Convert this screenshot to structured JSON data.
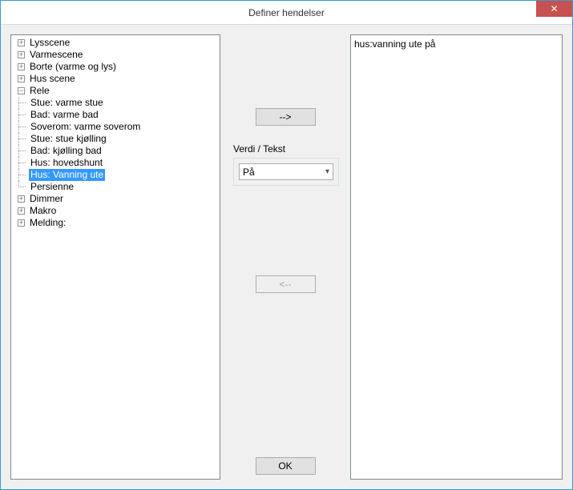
{
  "window": {
    "title": "Definer hendelser",
    "close_glyph": "✕"
  },
  "tree": {
    "items": [
      {
        "label": "Lysscene",
        "expanded": false,
        "children": []
      },
      {
        "label": "Varmescene",
        "expanded": false,
        "children": []
      },
      {
        "label": "Borte (varme og lys)",
        "expanded": false,
        "children": []
      },
      {
        "label": "Hus scene",
        "expanded": false,
        "children": []
      },
      {
        "label": "Rele",
        "expanded": true,
        "children": [
          {
            "label": "Stue: varme stue",
            "selected": false
          },
          {
            "label": "Bad: varme bad",
            "selected": false
          },
          {
            "label": "Soverom: varme soverom",
            "selected": false
          },
          {
            "label": "Stue: stue kjølling",
            "selected": false
          },
          {
            "label": "Bad: kjølling bad",
            "selected": false
          },
          {
            "label": "Hus: hovedshunt",
            "selected": false
          },
          {
            "label": "Hus: Vanning ute",
            "selected": true
          },
          {
            "label": "Persienne",
            "selected": false
          }
        ]
      },
      {
        "label": "Dimmer",
        "expanded": false,
        "children": []
      },
      {
        "label": "Makro",
        "expanded": false,
        "children": []
      },
      {
        "label": "Melding:",
        "expanded": false,
        "children": []
      }
    ]
  },
  "middle": {
    "add_label": "-->",
    "remove_label": "<--",
    "value_label": "Verdi / Tekst",
    "select_value": "På",
    "ok_label": "OK"
  },
  "right": {
    "items": [
      "hus:vanning ute på"
    ]
  }
}
